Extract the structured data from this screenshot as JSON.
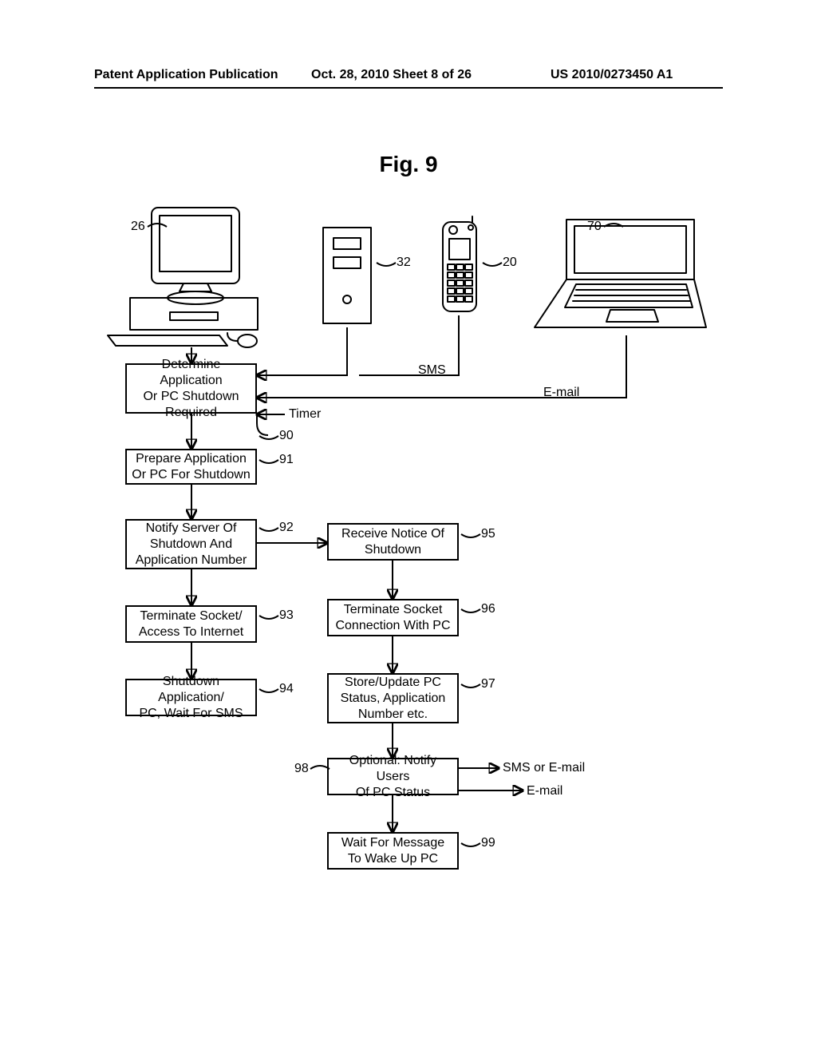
{
  "header": {
    "left": "Patent Application Publication",
    "center": "Oct. 28, 2010  Sheet 8 of 26",
    "right": "US 2010/0273450 A1"
  },
  "figure_title": "Fig. 9",
  "device_refs": {
    "pc": "26",
    "server": "32",
    "phone": "20",
    "laptop": "70"
  },
  "signals": {
    "sms": "SMS",
    "email": "E-mail",
    "timer": "Timer",
    "sms_or_email": "SMS or E-mail"
  },
  "left_col": {
    "b90": {
      "text": "Determine Application\nOr PC Shutdown\nRequired",
      "ref": "90"
    },
    "b91": {
      "text": "Prepare Application\nOr PC For Shutdown",
      "ref": "91"
    },
    "b92": {
      "text": "Notify Server Of\nShutdown And\nApplication Number",
      "ref": "92"
    },
    "b93": {
      "text": "Terminate Socket/\nAccess To Internet",
      "ref": "93"
    },
    "b94": {
      "text": "Shutdown Application/\nPC, Wait For SMS",
      "ref": "94"
    }
  },
  "right_col": {
    "b95": {
      "text": "Receive Notice Of\nShutdown",
      "ref": "95"
    },
    "b96": {
      "text": "Terminate Socket\nConnection With PC",
      "ref": "96"
    },
    "b97": {
      "text": "Store/Update PC\nStatus, Application\nNumber etc.",
      "ref": "97"
    },
    "b98": {
      "text": "Optional: Notify Users\nOf PC Status",
      "ref": "98"
    },
    "b99": {
      "text": "Wait For Message\nTo Wake Up PC",
      "ref": "99"
    }
  }
}
